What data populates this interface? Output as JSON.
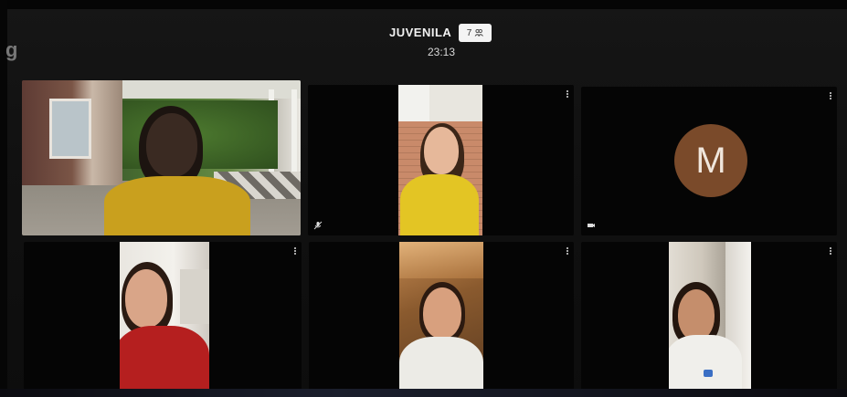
{
  "app": {
    "logo_letter": "g"
  },
  "header": {
    "room_name": "JUVENILA",
    "participant_count": "7",
    "timer": "23:13"
  },
  "tiles": [
    {
      "id": 1,
      "type": "video",
      "camera_on": true
    },
    {
      "id": 2,
      "type": "video",
      "camera_on": true
    },
    {
      "id": 3,
      "type": "avatar",
      "avatar_letter": "M",
      "avatar_color": "#7a4a2a"
    },
    {
      "id": 4,
      "type": "video",
      "camera_on": true
    },
    {
      "id": 5,
      "type": "video",
      "camera_on": true
    },
    {
      "id": 6,
      "type": "video",
      "camera_on": true
    }
  ],
  "colors": {
    "background": "#0d0d0d",
    "badge_bg": "#f4f4f4",
    "avatar": "#7a4a2a"
  }
}
